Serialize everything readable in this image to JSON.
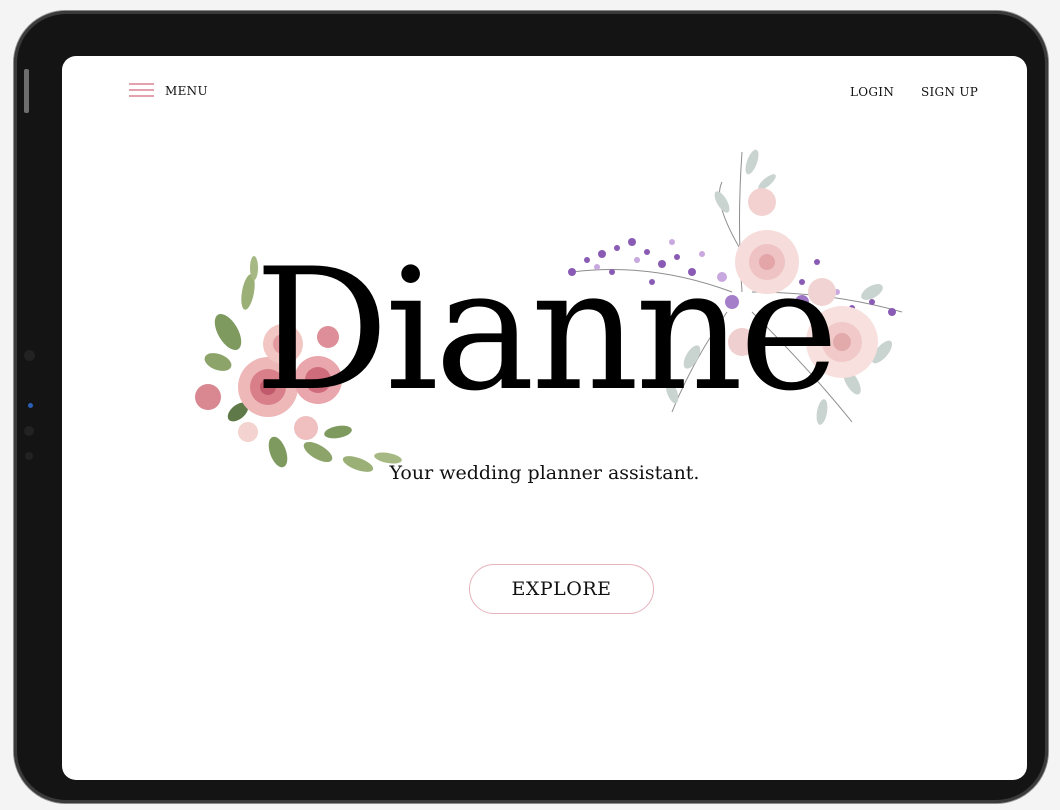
{
  "nav": {
    "menu_label": "MENU",
    "login_label": "LOGIN",
    "signup_label": "SIGN UP"
  },
  "hero": {
    "title": "Dianne",
    "tagline": "Your wedding planner assistant.",
    "cta_label": "EXPLORE"
  },
  "icons": {
    "menu": "hamburger-icon"
  },
  "colors": {
    "accent_pink": "#e4a1ae",
    "button_border": "#e7b3bd",
    "text": "#111111",
    "device_frame": "#141414"
  }
}
